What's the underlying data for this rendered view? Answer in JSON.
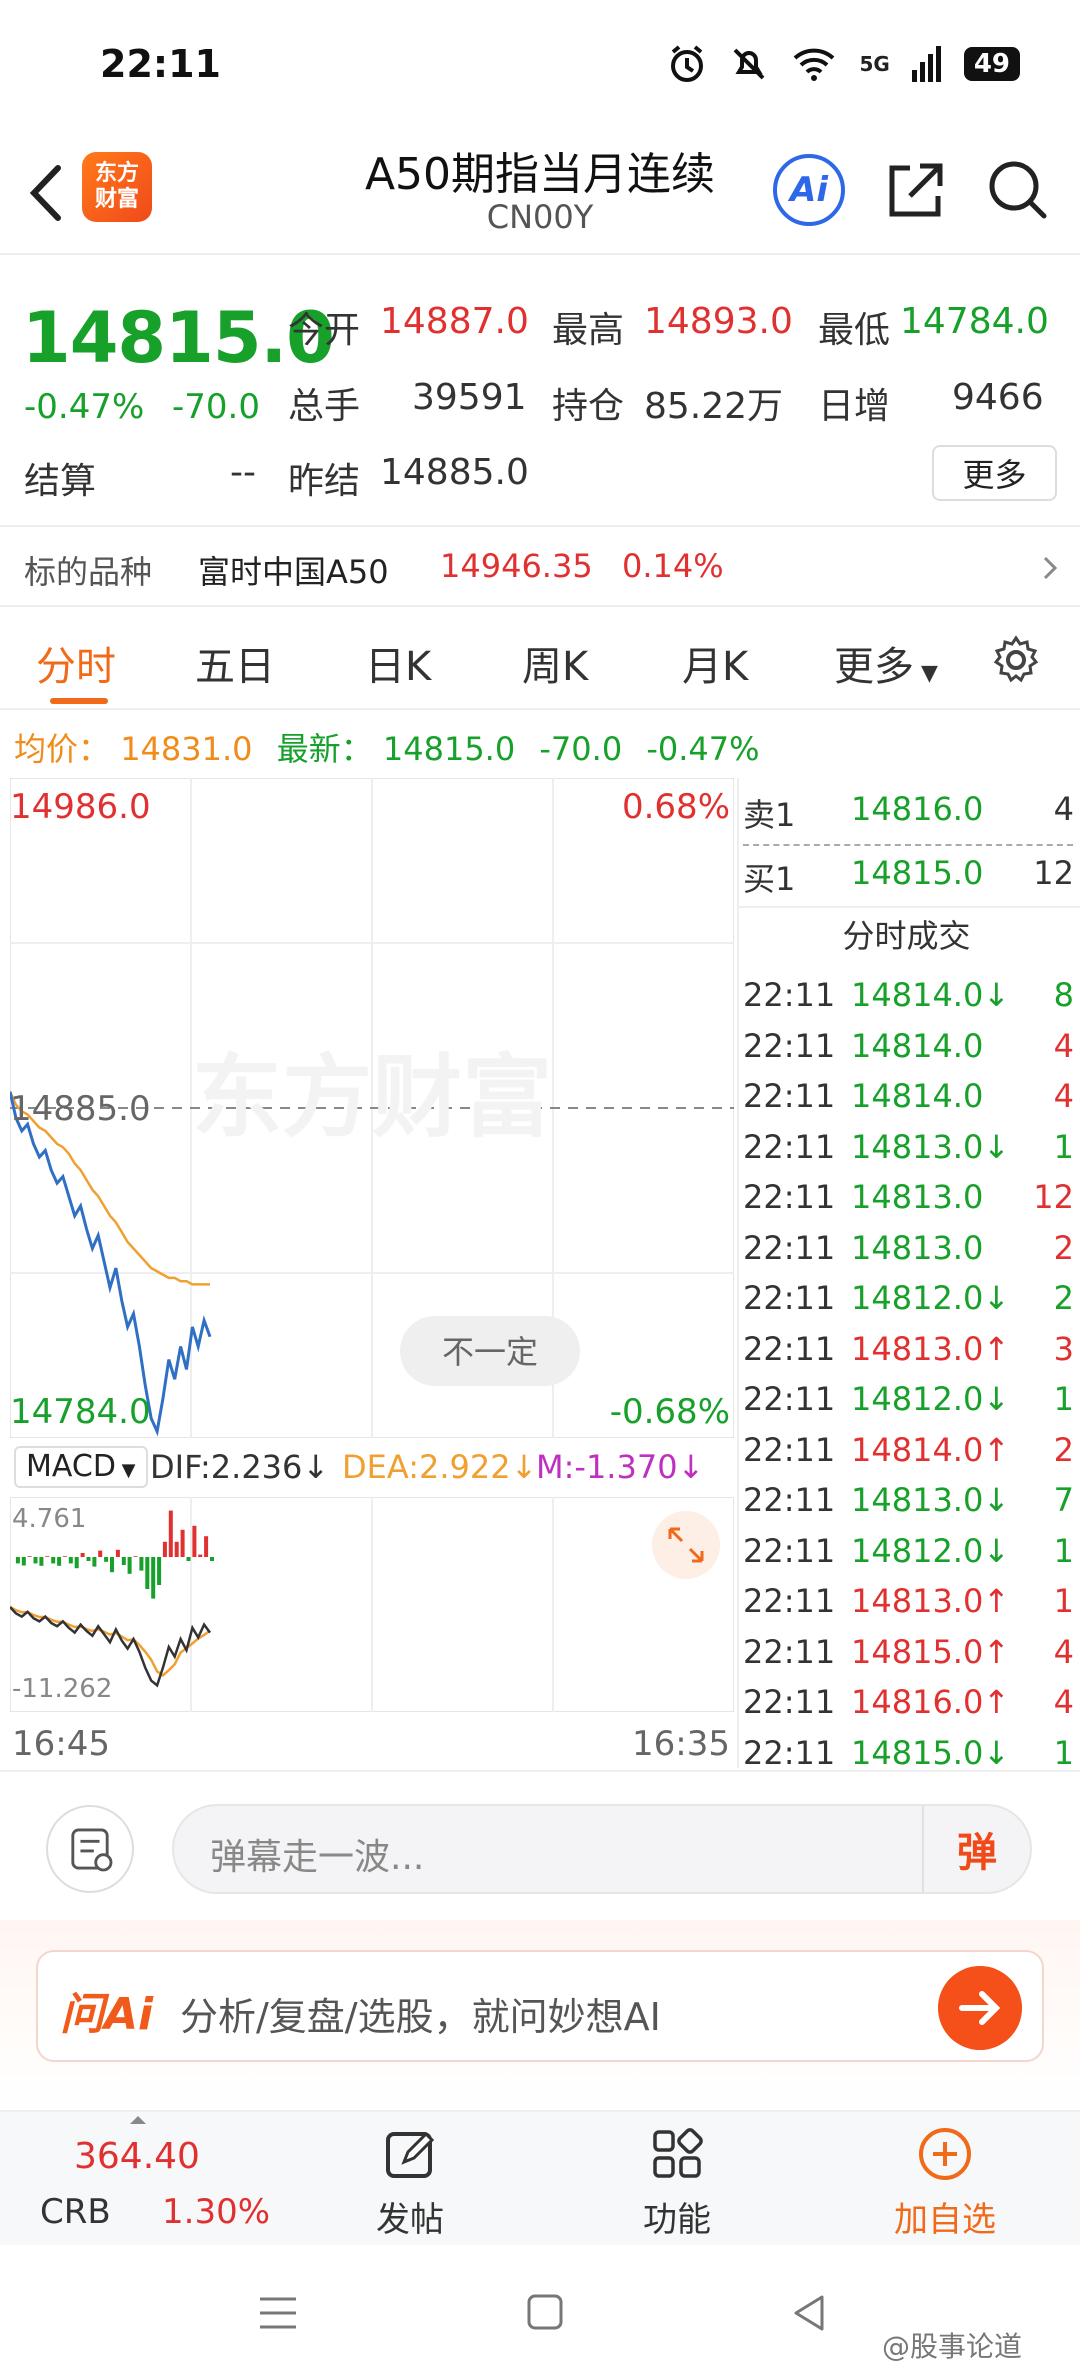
{
  "status_bar": {
    "time": "22:11",
    "network": "5G",
    "battery": "49"
  },
  "header": {
    "title": "A50期指当月连续",
    "code": "CN00Y",
    "logo_line1": "东方",
    "logo_line2": "财富",
    "ai_label": "Ai"
  },
  "quote": {
    "price": "14815.0",
    "change_pct": "-0.47%",
    "change": "-70.0",
    "open_label": "今开",
    "open": "14887.0",
    "high_label": "最高",
    "high": "14893.0",
    "low_label": "最低",
    "low": "14784.0",
    "volume_label": "总手",
    "volume": "39591",
    "oi_label": "持仓",
    "oi": "85.22万",
    "daily_inc_label": "日增",
    "daily_inc": "9466",
    "settle_label": "结算",
    "settle": "--",
    "prev_settle_label": "昨结",
    "prev_settle": "14885.0",
    "more_label": "更多"
  },
  "underlying": {
    "label": "标的品种",
    "name": "富时中国A50",
    "price": "14946.35",
    "pct": "0.14%"
  },
  "tabs": [
    "分时",
    "五日",
    "日K",
    "周K",
    "月K",
    "更多"
  ],
  "avg_line": {
    "avg_label": "均价：",
    "avg": "14831.0",
    "latest_label": "最新：",
    "latest": "14815.0",
    "chg": "-70.0",
    "pct": "-0.47%"
  },
  "chart": {
    "top_price": "14986.0",
    "top_pct": "0.68%",
    "mid_price": "14885.0",
    "bottom_price": "14784.0",
    "bottom_pct": "-0.68%",
    "watermark": "东方财富",
    "tooltip": "不一定",
    "time_start": "16:45",
    "time_end": "16:35"
  },
  "chart_data": {
    "type": "line",
    "title": "",
    "ylim": [
      14784.0,
      14986.0
    ],
    "series": [
      {
        "values": [
          14890,
          14882,
          14878,
          14880,
          14874,
          14870,
          14872,
          14866,
          14862,
          14864,
          14858,
          14852,
          14855,
          14848,
          14842,
          14846,
          14838,
          14830,
          14836,
          14826,
          14818,
          14822,
          14812,
          14800,
          14790,
          14786,
          14796,
          14808,
          14802,
          14812,
          14805,
          14818,
          14812,
          14820,
          14815
        ]
      },
      {
        "values": [
          14890,
          14886,
          14884,
          14883,
          14881,
          14879,
          14878,
          14876,
          14874,
          14873,
          14871,
          14868,
          14866,
          14863,
          14860,
          14858,
          14855,
          14852,
          14850,
          14847,
          14844,
          14842,
          14840,
          14838,
          14836,
          14835,
          14834,
          14833,
          14833,
          14832,
          14832,
          14831,
          14831,
          14831,
          14831
        ]
      }
    ]
  },
  "macd": {
    "label": "MACD",
    "dif": "DIF:2.236",
    "dea": "DEA:2.922",
    "m": "M:-1.370",
    "max": "4.761",
    "min": "-11.262"
  },
  "book": {
    "sell1_label": "卖1",
    "sell1_price": "14816.0",
    "sell1_vol": "4",
    "buy1_label": "买1",
    "buy1_price": "14815.0",
    "buy1_vol": "12",
    "title": "分时成交",
    "trades": [
      {
        "time": "22:11",
        "price": "14814.0",
        "arrow": "↓",
        "vol": "8",
        "dir": "down"
      },
      {
        "time": "22:11",
        "price": "14814.0",
        "arrow": "",
        "vol": "4",
        "dir": "flat"
      },
      {
        "time": "22:11",
        "price": "14814.0",
        "arrow": "",
        "vol": "4",
        "dir": "flat"
      },
      {
        "time": "22:11",
        "price": "14813.0",
        "arrow": "↓",
        "vol": "1",
        "dir": "down"
      },
      {
        "time": "22:11",
        "price": "14813.0",
        "arrow": "",
        "vol": "12",
        "dir": "flat"
      },
      {
        "time": "22:11",
        "price": "14813.0",
        "arrow": "",
        "vol": "2",
        "dir": "flat"
      },
      {
        "time": "22:11",
        "price": "14812.0",
        "arrow": "↓",
        "vol": "2",
        "dir": "down"
      },
      {
        "time": "22:11",
        "price": "14813.0",
        "arrow": "↑",
        "vol": "3",
        "dir": "up"
      },
      {
        "time": "22:11",
        "price": "14812.0",
        "arrow": "↓",
        "vol": "1",
        "dir": "down"
      },
      {
        "time": "22:11",
        "price": "14814.0",
        "arrow": "↑",
        "vol": "2",
        "dir": "up"
      },
      {
        "time": "22:11",
        "price": "14813.0",
        "arrow": "↓",
        "vol": "7",
        "dir": "down"
      },
      {
        "time": "22:11",
        "price": "14812.0",
        "arrow": "↓",
        "vol": "1",
        "dir": "down"
      },
      {
        "time": "22:11",
        "price": "14813.0",
        "arrow": "↑",
        "vol": "1",
        "dir": "up"
      },
      {
        "time": "22:11",
        "price": "14815.0",
        "arrow": "↑",
        "vol": "4",
        "dir": "up"
      },
      {
        "time": "22:11",
        "price": "14816.0",
        "arrow": "↑",
        "vol": "4",
        "dir": "up"
      },
      {
        "time": "22:11",
        "price": "14815.0",
        "arrow": "↓",
        "vol": "1",
        "dir": "down"
      }
    ]
  },
  "comment": {
    "placeholder": "弹幕走一波...",
    "send_label": "弹"
  },
  "ask_ai": {
    "logo": "问Ai",
    "text": "分析/复盘/选股，就问妙想AI"
  },
  "bottom_bar": {
    "crb_price": "364.40",
    "crb_label": "CRB",
    "crb_pct": "1.30%",
    "post_label": "发帖",
    "func_label": "功能",
    "add_label": "加自选"
  },
  "watermark": "@股事论道",
  "colors": {
    "up": "#e0302f",
    "down": "#17a02a",
    "accent": "#f06a1a",
    "price_line": "#2f6fc4",
    "avg_line": "#f0a030"
  }
}
